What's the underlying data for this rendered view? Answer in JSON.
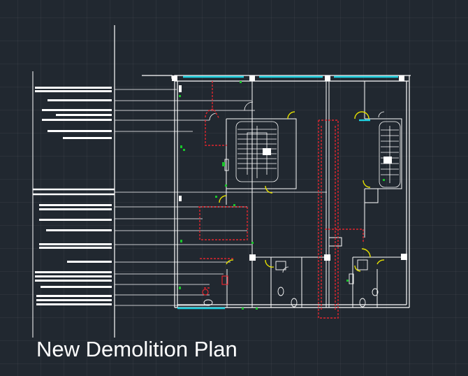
{
  "drawing": {
    "title": "New Demolition Plan"
  },
  "colors": {
    "background": "#212830",
    "wall": "#ffffff",
    "leader": "#ffffff",
    "demolition": "#e0262e",
    "window": "#1fd1e0",
    "door": "#e5e000",
    "fixture_marker": "#19c42b"
  },
  "legend": {
    "note_count": 16,
    "text_rendering": "illegible-bars"
  }
}
